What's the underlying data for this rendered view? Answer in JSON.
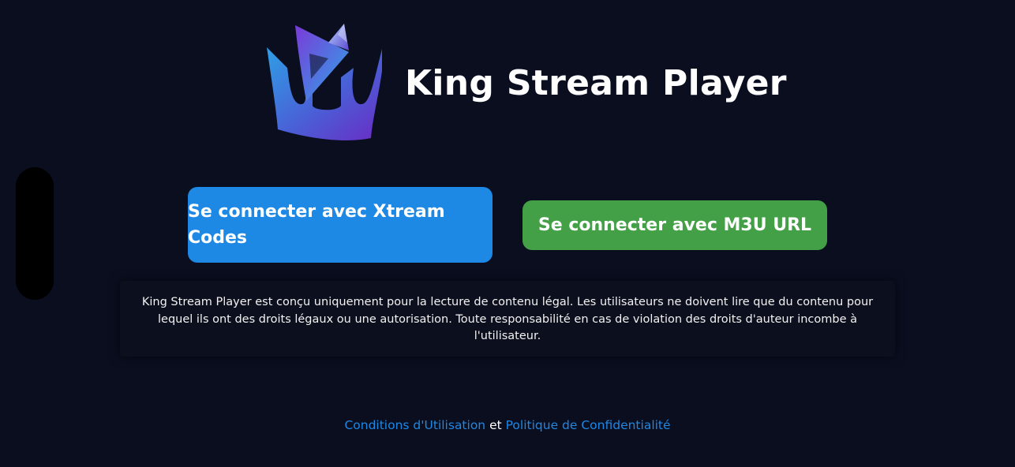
{
  "app": {
    "title": "King Stream Player"
  },
  "buttons": {
    "xtream_label": "Se connecter avec Xtream Codes",
    "m3u_label": "Se connecter avec M3U URL"
  },
  "disclaimer": {
    "text": "King Stream Player est conçu uniquement pour la lecture de contenu légal. Les utilisateurs ne doivent lire que du contenu pour lequel ils ont des droits légaux ou une autorisation. Toute responsabilité en cas de violation des droits d'auteur incombe à l'utilisateur."
  },
  "footer": {
    "terms_label": "Conditions d'Utilisation",
    "conjunction": "et",
    "privacy_label": "Politique de Confidentialité"
  },
  "icons": {
    "logo": "crown-play-logo-icon"
  },
  "colors": {
    "background": "#0a0e1f",
    "xtream_button": "#1e88e5",
    "m3u_button": "#43a047",
    "link": "#1e88e5"
  }
}
